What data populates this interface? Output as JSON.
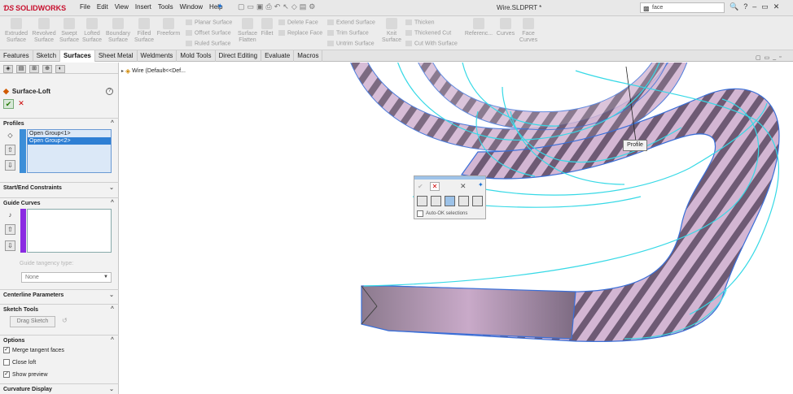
{
  "app": {
    "brand": "SOLIDWORKS",
    "doc_title": "Wire.SLDPRT *",
    "search_value": "face"
  },
  "menu": [
    "File",
    "Edit",
    "View",
    "Insert",
    "Tools",
    "Window",
    "Help"
  ],
  "ribbon": {
    "big_buttons": [
      {
        "l1": "Extruded",
        "l2": "Surface"
      },
      {
        "l1": "Revolved",
        "l2": "Surface"
      },
      {
        "l1": "Swept",
        "l2": "Surface"
      },
      {
        "l1": "Lofted",
        "l2": "Surface"
      },
      {
        "l1": "Boundary",
        "l2": "Surface"
      },
      {
        "l1": "Filled",
        "l2": "Surface"
      },
      {
        "l1": "Freeform",
        "l2": ""
      }
    ],
    "small_buttons": [
      "Planar Surface",
      "Offset Surface",
      "Ruled Surface",
      "Surface Flatten",
      "Delete Face",
      "Replace Face",
      "Extend Surface",
      "Trim Surface",
      "Untrim Surface",
      "Thicken",
      "Thickened Cut",
      "Cut With Surface"
    ],
    "mid_buttons": [
      {
        "l1": "Surface",
        "l2": "Flatten"
      },
      {
        "l1": "Fillet",
        "l2": ""
      },
      {
        "l1": "Knit",
        "l2": "Surface"
      },
      {
        "l1": "Referenc...",
        "l2": ""
      },
      {
        "l1": "Curves",
        "l2": ""
      },
      {
        "l1": "Face",
        "l2": "Curves"
      }
    ]
  },
  "tabs": [
    "Features",
    "Sketch",
    "Surfaces",
    "Sheet Metal",
    "Weldments",
    "Mold Tools",
    "Direct Editing",
    "Evaluate",
    "Macros"
  ],
  "panel": {
    "title": "Surface-Loft",
    "sections": {
      "profiles": "Profiles",
      "start_end": "Start/End Constraints",
      "guide_curves": "Guide Curves",
      "centerline": "Centerline Parameters",
      "sketch_tools": "Sketch Tools",
      "options": "Options",
      "curvature": "Curvature Display"
    },
    "profiles": [
      "Open Group<1>",
      "Open Group<2>"
    ],
    "tangency_label": "Guide tangency type:",
    "tangency_value": "None",
    "drag_sketch": "Drag Sketch",
    "options": [
      {
        "label": "Merge tangent faces",
        "checked": true
      },
      {
        "label": "Close loft",
        "checked": false
      },
      {
        "label": "Show preview",
        "checked": true
      }
    ]
  },
  "tree": {
    "item": "Wire  (Default<<Def..."
  },
  "viewport": {
    "profile_tag": "Profile",
    "auto_ok": "Auto-OK selections"
  },
  "colors": {
    "loft_fill": "#c8a6c8",
    "loft_dark": "#6e5a74",
    "curve": "#37d9e6",
    "edge": "#3a6fd8"
  }
}
